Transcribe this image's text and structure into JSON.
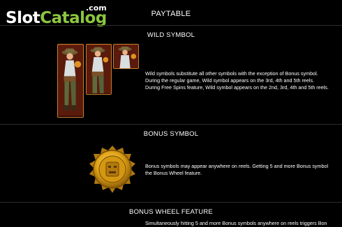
{
  "logo": {
    "part1": "Slot",
    "part2": "Catalog",
    "suffix": ".com"
  },
  "page": {
    "title": "PAYTABLE"
  },
  "sections": {
    "wild": {
      "title": "WILD SYMBOL",
      "icon": "explorer-wild-icon",
      "lines": [
        "Wild symbols substitute all other symbols with the exception of Bonus symbol.",
        "During the regular game, Wild symbol appears on the 3rd, 4th and 5th reels.",
        "During Free Spins feature, Wild symbol appears on the 2nd, 3rd, 4th and 5th reels."
      ]
    },
    "bonus": {
      "title": "BONUS SYMBOL",
      "icon": "golden-coin-icon",
      "lines": [
        "Bonus symbols may appear anywhere on reels. Getting 5 and more Bonus symbol",
        "the Bonus Wheel feature."
      ]
    },
    "bonus_wheel": {
      "title": "BONUS WHEEL FEATURE",
      "lines": [
        "Simultaneously hitting 5 and more Bonus symbols anywhere on reels triggers Bon"
      ]
    }
  },
  "colors": {
    "background": "#000000",
    "logo_green": "#8cc63f",
    "tile_border": "#c8802c",
    "coin_gold": "#e0a416"
  }
}
